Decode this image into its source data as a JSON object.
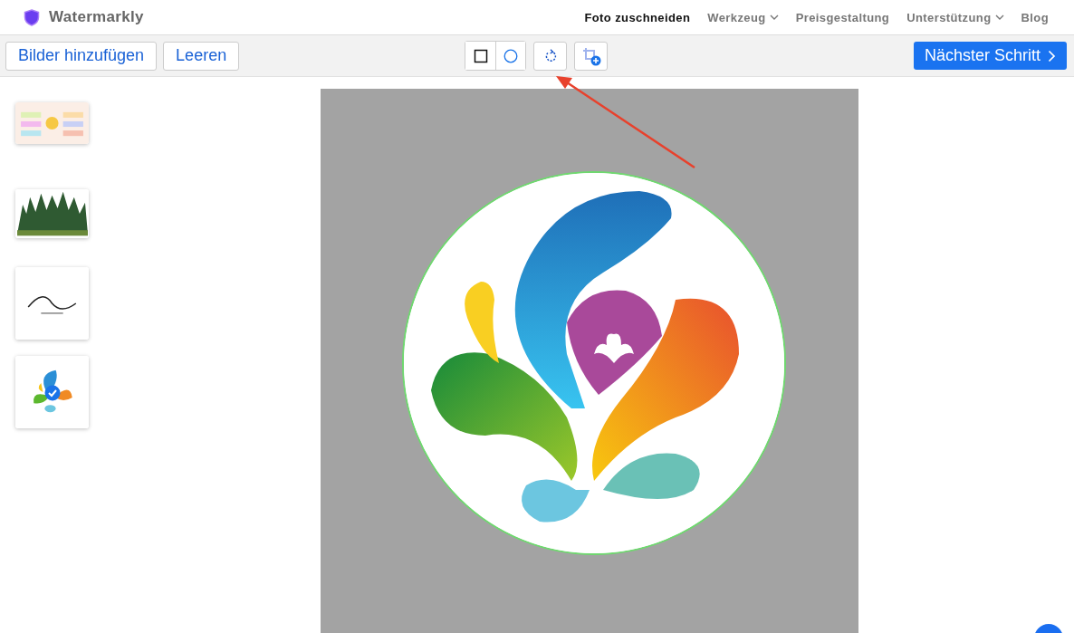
{
  "brand": {
    "name": "Watermarkly"
  },
  "nav": [
    {
      "label": "Foto zuschneiden",
      "selected": true,
      "has_menu": false
    },
    {
      "label": "Werkzeug",
      "selected": false,
      "has_menu": true
    },
    {
      "label": "Preisgestaltung",
      "selected": false,
      "has_menu": false
    },
    {
      "label": "Unterstützung",
      "selected": false,
      "has_menu": true
    },
    {
      "label": "Blog",
      "selected": false,
      "has_menu": false
    }
  ],
  "toolbar": {
    "buttons": [
      "Bilder hinzufügen",
      "Leeren"
    ],
    "shapes": [
      {
        "kind": "rectangle",
        "selected": false
      },
      {
        "kind": "circle",
        "selected": true
      }
    ],
    "tools": [
      {
        "kind": "rotate"
      },
      {
        "kind": "add-crop"
      }
    ],
    "next": "Nächster Schritt"
  },
  "thumbnails": [
    {
      "selected": false
    },
    {
      "selected": false
    },
    {
      "selected": false
    },
    {
      "selected": true
    }
  ]
}
